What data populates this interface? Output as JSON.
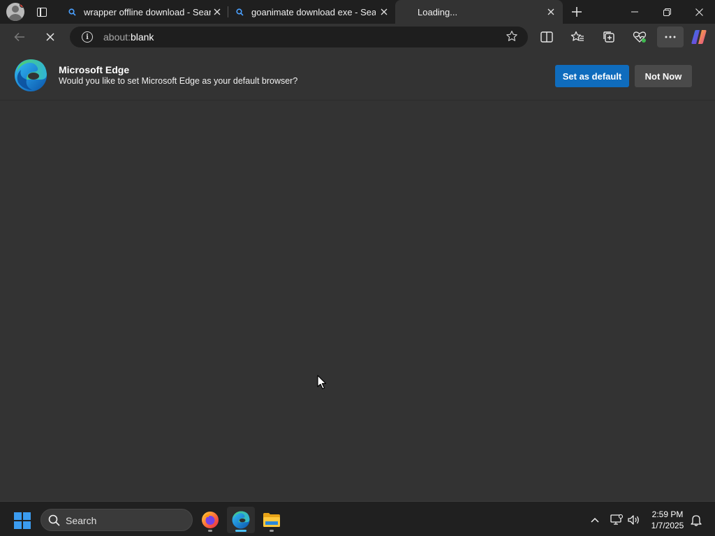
{
  "browser": {
    "tabs": [
      {
        "title": "wrapper offline download - Search",
        "favicon": "search-favicon",
        "active": false
      },
      {
        "title": "goanimate download exe - Search",
        "favicon": "search-favicon",
        "active": false
      },
      {
        "title": "Loading...",
        "favicon": "none",
        "active": true
      }
    ],
    "address": {
      "scheme": "about:",
      "path": "blank"
    }
  },
  "infobar": {
    "title": "Microsoft Edge",
    "message": "Would you like to set Microsoft Edge as your default browser?",
    "primary_label": "Set as default",
    "secondary_label": "Not Now"
  },
  "taskbar": {
    "search_placeholder": "Search",
    "apps": [
      "firefox-icon",
      "edge-icon",
      "file-explorer-icon"
    ],
    "time": "2:59 PM",
    "date": "1/7/2025"
  },
  "colors": {
    "accent": "#0f6cbd",
    "page_bg": "#333333",
    "titlebar_bg": "#1f1f1f",
    "taskbar_bg": "#202020"
  }
}
